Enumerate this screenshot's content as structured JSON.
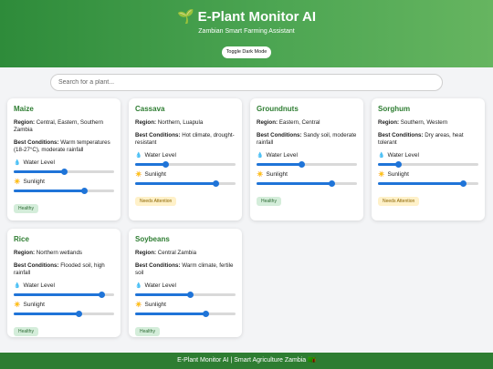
{
  "header": {
    "icon": "seedling-icon",
    "title": "E-Plant Monitor AI",
    "title_icon": "🌱",
    "subtitle": "Zambian Smart Farming Assistant",
    "toggle_label": "Toggle Dark Mode"
  },
  "search": {
    "placeholder": "Search for a plant...",
    "value": ""
  },
  "labels": {
    "region": "Region:",
    "best": "Best Conditions:",
    "water": "Water Level",
    "sun": "Sunlight",
    "water_icon": "💧",
    "sun_icon": "☀️"
  },
  "plants": [
    {
      "name": "Maize",
      "region": "Central, Eastern, Southern Zambia",
      "conditions": "Warm temperatures (18-27°C), moderate rainfall",
      "water": 0.5,
      "sun": 0.7,
      "status": "Healthy"
    },
    {
      "name": "Cassava",
      "region": "Northern, Luapula",
      "conditions": "Hot climate, drought-resistant",
      "water": 0.3,
      "sun": 0.8,
      "status": "Needs Attention"
    },
    {
      "name": "Groundnuts",
      "region": "Eastern, Central",
      "conditions": "Sandy soil, moderate rainfall",
      "water": 0.45,
      "sun": 0.75,
      "status": "Healthy"
    },
    {
      "name": "Sorghum",
      "region": "Southern, Western",
      "conditions": "Dry areas, heat tolerant",
      "water": 0.2,
      "sun": 0.85,
      "status": "Needs Attention"
    },
    {
      "name": "Rice",
      "region": "Northern wetlands",
      "conditions": "Flooded soil, high rainfall",
      "water": 0.88,
      "sun": 0.65,
      "status": "Healthy"
    },
    {
      "name": "Soybeans",
      "region": "Central Zambia",
      "conditions": "Warm climate, fertile soil",
      "water": 0.55,
      "sun": 0.7,
      "status": "Healthy"
    }
  ],
  "colors": {
    "brand_green": "#2e7d32",
    "slider_blue": "#1f74d8",
    "healthy_bg": "#d4edda",
    "attention_bg": "#fff1c9"
  },
  "footer": {
    "text": "E-Plant Monitor AI | Smart Agriculture Zambia",
    "icon": "🇿🇲"
  }
}
